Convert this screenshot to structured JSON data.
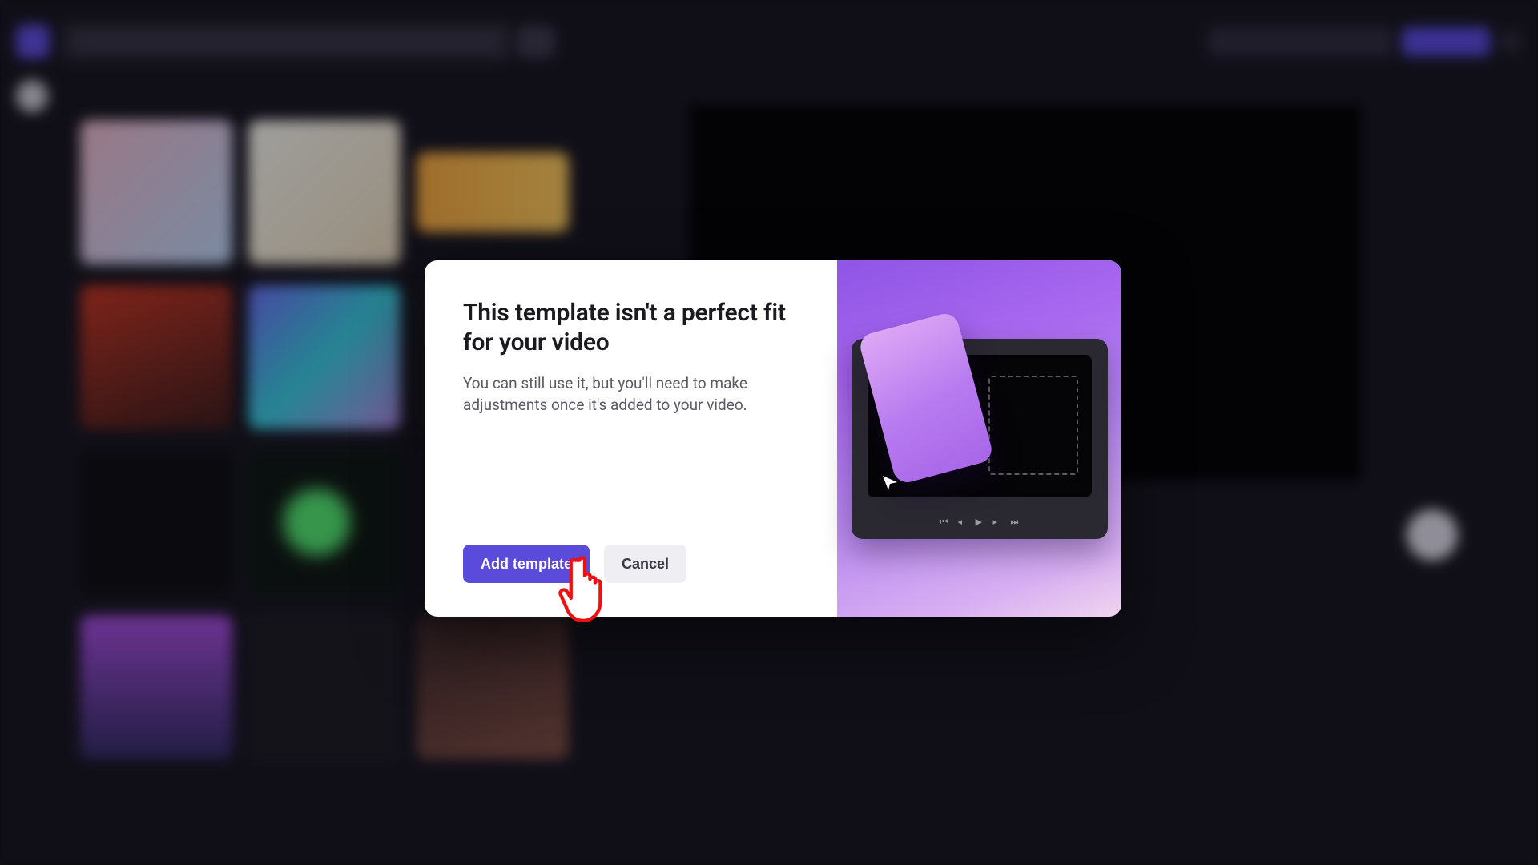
{
  "modal": {
    "title": "This template isn't a perfect fit for your video",
    "body": "You can still use it, but you'll need to make adjustments once it's added to your video.",
    "primary_label": "Add template",
    "secondary_label": "Cancel"
  },
  "colors": {
    "accent": "#5b4bda"
  }
}
